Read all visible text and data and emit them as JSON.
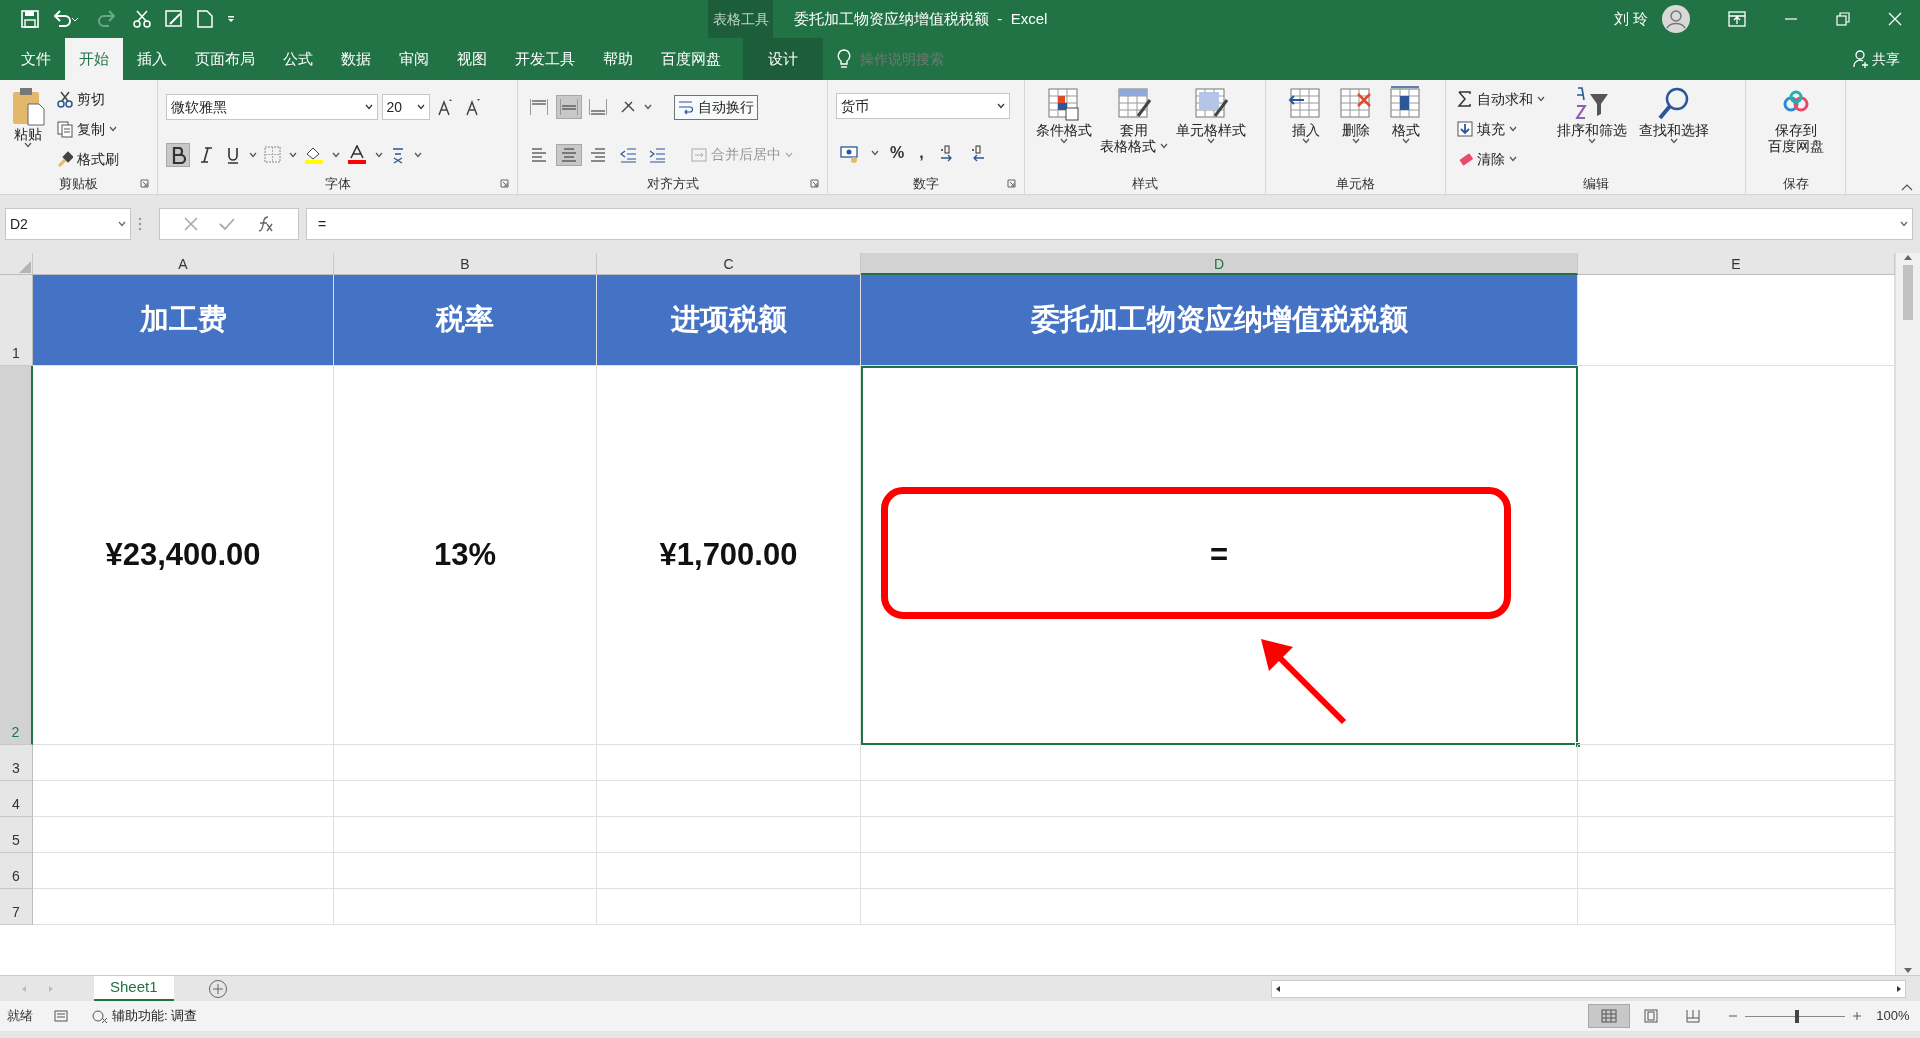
{
  "title_bar": {
    "context_label": "表格工具",
    "title": "委托加工物资应纳增值税税额  -  Excel",
    "user": "刘 玲"
  },
  "ribbon_tabs": [
    {
      "label": "文件",
      "selected": false
    },
    {
      "label": "开始",
      "selected": true
    },
    {
      "label": "插入",
      "selected": false
    },
    {
      "label": "页面布局",
      "selected": false
    },
    {
      "label": "公式",
      "selected": false
    },
    {
      "label": "数据",
      "selected": false
    },
    {
      "label": "审阅",
      "selected": false
    },
    {
      "label": "视图",
      "selected": false
    },
    {
      "label": "开发工具",
      "selected": false
    },
    {
      "label": "帮助",
      "selected": false
    },
    {
      "label": "百度网盘",
      "selected": false
    },
    {
      "label": "设计",
      "selected": false,
      "kind": "contextual"
    }
  ],
  "tell_me": {
    "placeholder": "操作说明搜索"
  },
  "share": "共享",
  "clipboard": {
    "label": "剪贴板",
    "paste": "粘贴",
    "items": [
      "剪切",
      "复制",
      "格式刷"
    ]
  },
  "font": {
    "label": "字体",
    "name": "微软雅黑",
    "size": "20",
    "bold": true
  },
  "alignment": {
    "label": "对齐方式",
    "wrap_text": {
      "label": "自动换行",
      "pressed": true
    },
    "merge": {
      "label": "合并后居中",
      "disabled": true
    },
    "vertical": [
      {
        "selected": false
      },
      {
        "selected": true
      },
      {
        "selected": false
      }
    ],
    "horizontal": [
      {
        "selected": false
      },
      {
        "selected": true
      },
      {
        "selected": false
      }
    ]
  },
  "number": {
    "label": "数字",
    "format": "货币",
    "symbols": [
      "%",
      ","
    ]
  },
  "styles": {
    "label": "样式",
    "buttons": [
      [
        "条件格式"
      ],
      [
        "套用",
        "表格格式"
      ],
      [
        "单元格样式"
      ]
    ]
  },
  "cells": {
    "label": "单元格",
    "buttons": [
      "插入",
      "删除",
      "格式"
    ]
  },
  "editing": {
    "label": "编辑",
    "small": [
      "自动求和",
      "填充",
      "清除"
    ],
    "buttons": [
      "排序和筛选",
      "查找和选择"
    ]
  },
  "save": {
    "label": "保存",
    "button": [
      "保存到",
      "百度网盘"
    ]
  },
  "formula_bar": {
    "name_box": "D2",
    "formula": "="
  },
  "columns": [
    {
      "label": "A",
      "selected": false
    },
    {
      "label": "B",
      "selected": false
    },
    {
      "label": "C",
      "selected": false
    },
    {
      "label": "D",
      "selected": true
    },
    {
      "label": "E",
      "selected": false
    }
  ],
  "rows": [
    {
      "label": "1",
      "selected": false,
      "cells": [
        "加工费",
        "税率",
        "进项税额",
        "委托加工物资应纳增值税税额"
      ]
    },
    {
      "label": "2",
      "selected": true,
      "cells": [
        "¥23,400.00",
        "13%",
        "¥1,700.00",
        "="
      ]
    },
    {
      "label": "3",
      "selected": false,
      "cells": []
    },
    {
      "label": "4",
      "selected": false,
      "cells": []
    },
    {
      "label": "5",
      "selected": false,
      "cells": []
    },
    {
      "label": "6",
      "selected": false,
      "cells": []
    },
    {
      "label": "7",
      "selected": false,
      "cells": []
    }
  ],
  "sheet_tabs": [
    {
      "label": "Sheet1",
      "selected": true
    }
  ],
  "status_bar": {
    "ready": "就绪",
    "accessibility": "辅助功能: 调查",
    "zoom": "100%",
    "zoom_slider": {
      "level": 0.5
    }
  }
}
